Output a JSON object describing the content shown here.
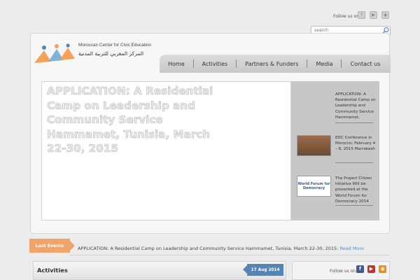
{
  "header": {
    "follow_label": "Follow us on :",
    "social_icons": [
      "facebook-icon",
      "youtube-icon",
      "rss-icon"
    ],
    "search_placeholder": "search"
  },
  "logo": {
    "name_en": "Moroccan Center for Civic Education",
    "name_ar": "المركز المغربي للتربية المدنية"
  },
  "nav": {
    "items": [
      "Home",
      "Activities",
      "Partners & Funders",
      "Media",
      "Contact us"
    ]
  },
  "slider": {
    "main_title": "APPLICATION: A Residential Camp on Leadership and Community Service Hammamet, Tunisia, March 22-30, 2015",
    "side": [
      {
        "text": "APPLICATION: A Residential Camp on Leadership and Community Service Hammamet,"
      },
      {
        "text": "EDC Conference in Morocco: February 4 – 8, 2015 Marrakesh"
      },
      {
        "text": "The Project Citizen intiative Will be presented at the World Forum for Democracy 2014",
        "thumb_text": "World Forum for Democracy"
      }
    ]
  },
  "events": {
    "label": "Last Events",
    "text": "APPLICATION: A Residential Camp on Leadership and Community Service Hammamet, Tunisia, March 22-30, 2015:",
    "link": "Read More"
  },
  "activities": {
    "title": "Activities",
    "date": "17 Aug 2014",
    "follow_label": "Follow us on :"
  },
  "colors": {
    "accent_orange": "#f0a36a",
    "accent_blue": "#5585b8",
    "nav_gray": "#c8c8c8"
  }
}
